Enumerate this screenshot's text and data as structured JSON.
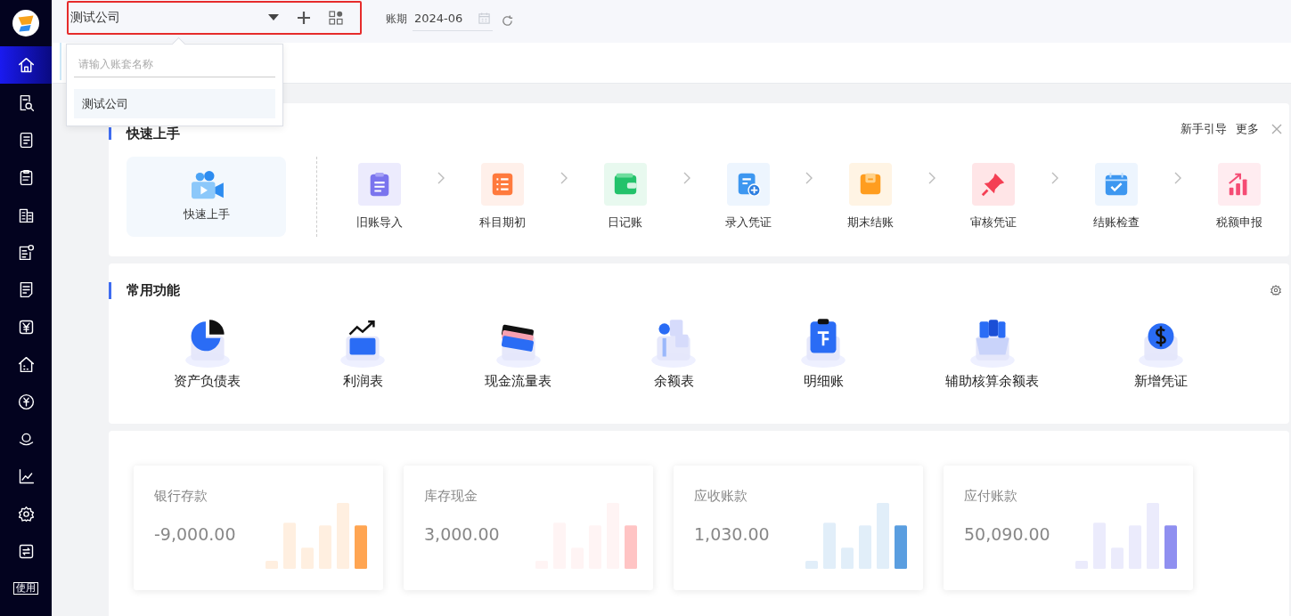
{
  "company_switcher": {
    "value": "测试公司"
  },
  "period": {
    "label": "账期",
    "value": "2024-06"
  },
  "company_dropdown": {
    "search": {
      "placeholder": "请输入账套名称"
    },
    "options": [
      {
        "label": "测试公司",
        "selected": true
      }
    ]
  },
  "sidebar": {
    "items": [
      {
        "kind": "home",
        "selected": true
      },
      {
        "kind": "search-doc",
        "selected": false
      },
      {
        "kind": "list",
        "selected": false
      },
      {
        "kind": "clipboard",
        "selected": false
      },
      {
        "kind": "buildings",
        "selected": false
      },
      {
        "kind": "doc-coin",
        "selected": false
      },
      {
        "kind": "doc",
        "selected": false
      },
      {
        "kind": "yen",
        "selected": false
      },
      {
        "kind": "house",
        "selected": false
      },
      {
        "kind": "yen-circle",
        "selected": false
      },
      {
        "kind": "coin",
        "selected": false
      },
      {
        "kind": "chart",
        "selected": false
      },
      {
        "kind": "gear",
        "selected": false
      },
      {
        "kind": "swap",
        "selected": false
      },
      {
        "kind": "guide",
        "selected": false,
        "label": "使用"
      }
    ]
  },
  "quick_start": {
    "title": "快速上手",
    "links": [
      "新手引导",
      "更多"
    ],
    "video": {
      "label": "快速上手"
    },
    "steps": [
      {
        "label": "旧账导入",
        "kind": "clipboard"
      },
      {
        "label": "科目期初",
        "kind": "list"
      },
      {
        "label": "日记账",
        "kind": "wallet"
      },
      {
        "label": "录入凭证",
        "kind": "doc-plus"
      },
      {
        "label": "期末结账",
        "kind": "folder"
      },
      {
        "label": "审核凭证",
        "kind": "pin"
      },
      {
        "label": "结账检查",
        "kind": "calendar"
      },
      {
        "label": "税额申报",
        "kind": "growth"
      }
    ]
  },
  "common_functions": {
    "title": "常用功能",
    "items": [
      {
        "label": "资产负债表",
        "kind": "pie"
      },
      {
        "label": "利润表",
        "kind": "trend"
      },
      {
        "label": "现金流量表",
        "kind": "cards"
      },
      {
        "label": "余额表",
        "kind": "cubes"
      },
      {
        "label": "明细账",
        "kind": "clipboard"
      },
      {
        "label": "辅助核算余额表",
        "kind": "box"
      },
      {
        "label": "新增凭证",
        "kind": "dollar"
      }
    ]
  },
  "stats": [
    {
      "label": "银行存款",
      "value": "-9,000.00",
      "color": "#ffa552"
    },
    {
      "label": "库存现金",
      "value": "3,000.00",
      "color": "#ffc4c4"
    },
    {
      "label": "应收账款",
      "value": "1,030.00",
      "color": "#5a9ee0"
    },
    {
      "label": "应付账款",
      "value": "50,090.00",
      "color": "#8f8ff0"
    }
  ]
}
